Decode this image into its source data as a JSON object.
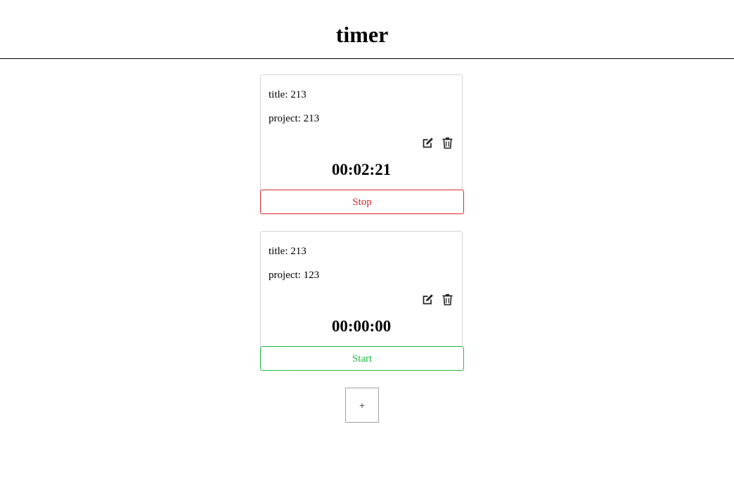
{
  "header": {
    "title": "timer"
  },
  "timers": [
    {
      "title_line": "title: 213",
      "project_line": "project: 213",
      "elapsed": "00:02:21",
      "action_label": "Stop"
    },
    {
      "title_line": "title: 213",
      "project_line": "project: 123",
      "elapsed": "00:00:00",
      "action_label": "Start"
    }
  ],
  "icons": {
    "edit": "edit-icon",
    "delete": "trash-icon"
  },
  "colors": {
    "stop": "#db2828",
    "start": "#21ba45",
    "card_border": "#d4d4d4"
  },
  "add_button": {
    "label": "+"
  }
}
